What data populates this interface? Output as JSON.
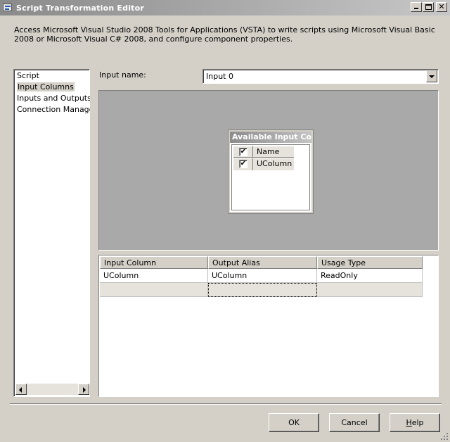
{
  "window": {
    "title": "Script Transformation Editor",
    "description": "Access Microsoft Visual Studio 2008 Tools for Applications (VSTA) to write scripts using Microsoft Visual Basic 2008 or Microsoft Visual C# 2008, and configure component properties."
  },
  "nav": {
    "items": [
      {
        "label": "Script",
        "selected": false
      },
      {
        "label": "Input Columns",
        "selected": true
      },
      {
        "label": "Inputs and Outputs",
        "selected": false
      },
      {
        "label": "Connection Managers",
        "selected": false
      }
    ]
  },
  "input_name": {
    "label": "Input name:",
    "value": "Input 0"
  },
  "available_columns": {
    "title": "Available Input Co",
    "header": {
      "check": "✔",
      "label": "Name"
    },
    "rows": [
      {
        "checked": true,
        "check": "✔",
        "name": "UColumn"
      }
    ]
  },
  "mapping_grid": {
    "columns": [
      "Input Column",
      "Output Alias",
      "Usage Type"
    ],
    "rows": [
      [
        "UColumn",
        "UColumn",
        "ReadOnly"
      ]
    ]
  },
  "buttons": {
    "ok": "OK",
    "cancel": "Cancel",
    "help_prefix": "H",
    "help_rest": "elp"
  },
  "icons": {
    "app": "script-editor-icon",
    "minimize": "minimize-icon",
    "maximize": "maximize-icon",
    "close": "close-icon"
  },
  "colors": {
    "titlebar_start": "#8a8a8a",
    "surface": "#a9a9a9",
    "face": "#d4d0c8"
  }
}
